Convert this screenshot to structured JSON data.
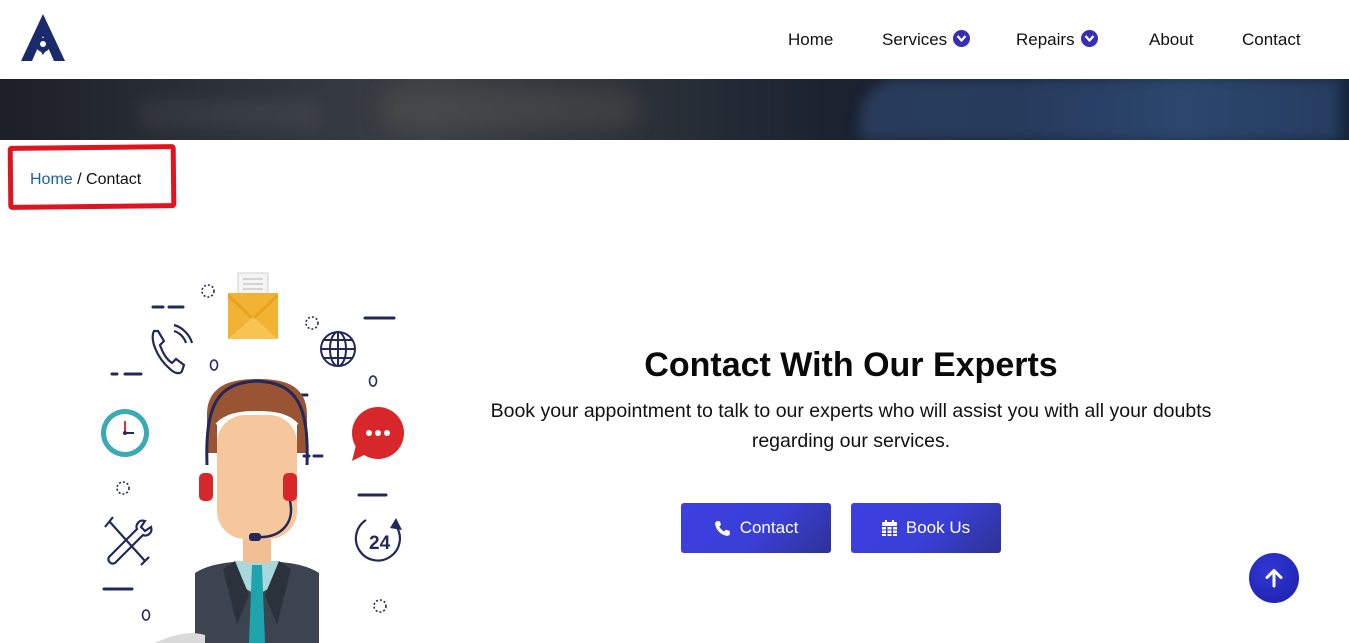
{
  "header": {
    "logo_alt": "A",
    "nav": [
      {
        "label": "Home",
        "has_dropdown": false
      },
      {
        "label": "Services",
        "has_dropdown": true
      },
      {
        "label": "Repairs",
        "has_dropdown": true
      },
      {
        "label": "About",
        "has_dropdown": false
      },
      {
        "label": "Contact",
        "has_dropdown": false
      }
    ]
  },
  "breadcrumb": {
    "home_label": "Home",
    "separator": " / ",
    "current_label": "Contact"
  },
  "cta": {
    "title": "Contact With Our Experts",
    "subtitle": "Book your appointment to talk to our experts who will assist you with all your doubts regarding our services.",
    "contact_button": "Contact",
    "book_button": "Book Us"
  },
  "illustration": {
    "icons": [
      "phone-icon",
      "envelope-icon",
      "globe-icon",
      "clock-icon",
      "chat-bubble-icon",
      "tools-icon",
      "24h-icon"
    ],
    "clock_label": "24"
  },
  "colors": {
    "accent": "#3530b6",
    "button": "#3a3fd6",
    "breadcrumb_link": "#1a5fa8",
    "highlight": "#e0141e"
  }
}
